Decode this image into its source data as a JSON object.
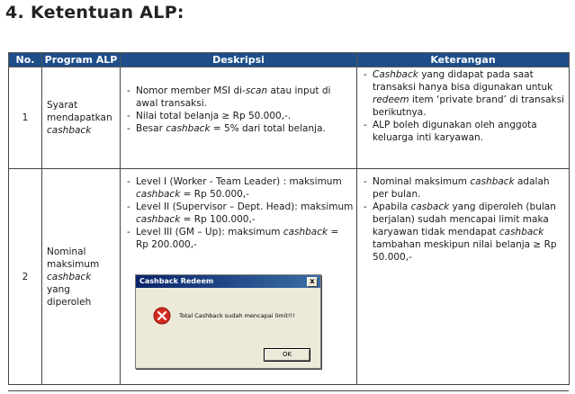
{
  "heading": "4. Ketentuan ALP:",
  "table": {
    "headers": {
      "no": "No.",
      "program": "Program ALP",
      "deskripsi": "Deskripsi",
      "keterangan": "Keterangan"
    },
    "rows": [
      {
        "no": "1",
        "program": [
          "Syarat",
          "mendapatkan",
          "cashback"
        ],
        "deskripsi": [
          [
            "Nomor member MSI di-",
            "scan",
            " atau input di awal transaksi."
          ],
          [
            "Nilai total belanja ≥ Rp 50.000,-."
          ],
          [
            "Besar ",
            "cashback",
            " = 5% dari total belanja."
          ]
        ],
        "keterangan": [
          [
            "",
            "Cashback",
            " yang didapat pada saat transaksi hanya bisa digunakan untuk ",
            "redeem",
            " item ‘private brand’ di transaksi berikutnya."
          ],
          [
            "ALP boleh digunakan oleh anggota keluarga inti karyawan."
          ]
        ]
      },
      {
        "no": "2",
        "program": [
          "Nominal",
          "maksimum",
          "cashback",
          "yang",
          "diperoleh"
        ],
        "deskripsi": [
          [
            "Level I (Worker - Team Leader) : maksimum ",
            "cashback",
            " = Rp 50.000,-"
          ],
          [
            "Level II (Supervisor – Dept. Head): maksimum ",
            "cashback",
            " = Rp 100.000,-"
          ],
          [
            "Level III (GM – Up): maksimum ",
            "cashback",
            " = Rp 200.000,-"
          ]
        ],
        "keterangan": [
          [
            "Nominal maksimum ",
            "cashback",
            " adalah per bulan."
          ],
          [
            "Apabila ",
            "casback",
            " yang diperoleh (bulan berjalan) sudah mencapai limit maka karyawan tidak mendapat ",
            "cashback",
            " tambahan meskipun nilai belanja  ≥ Rp 50.000,-"
          ]
        ]
      }
    ]
  },
  "dialog": {
    "title": "Cashback Redeem",
    "close_glyph": "x",
    "message": "Total Cashback sudah mencapai limit!!!",
    "ok_label": "OK",
    "icon": "error-icon",
    "colors": {
      "title_bar": "#0a246a",
      "error": "#d42a1e",
      "face": "#ece9d8"
    }
  },
  "colors": {
    "header_bg": "#1d4e8a",
    "header_text": "#ffffff"
  }
}
